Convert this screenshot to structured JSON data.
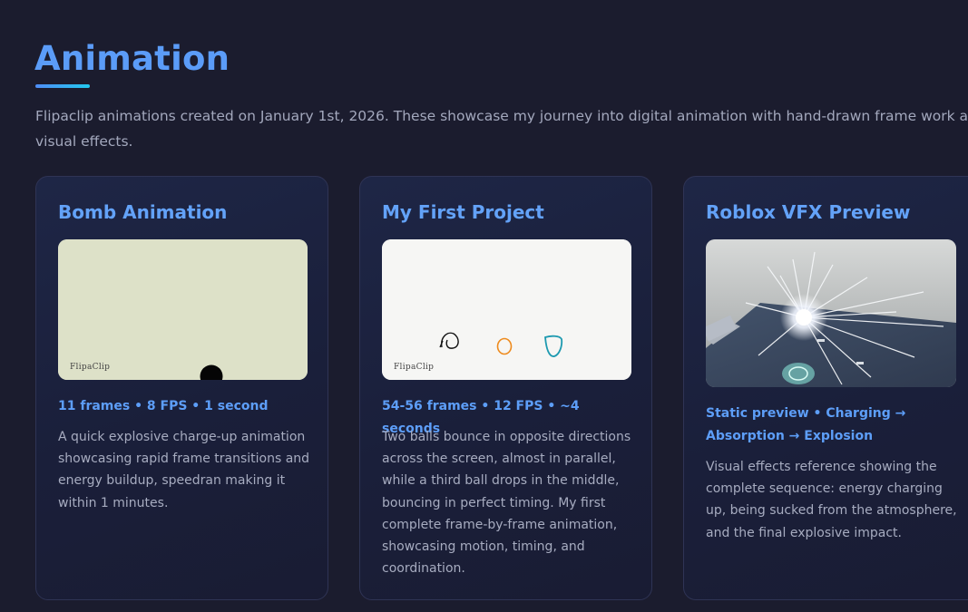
{
  "header": {
    "title": "Animation",
    "intro": "Flipaclip animations created on January 1st, 2026. These showcase my journey into digital animation with hand-drawn frame work and visual effects."
  },
  "colors": {
    "background": "#1b1c2e",
    "accent": "#5b9cf8",
    "underline_end": "#22c8ee",
    "card_border": "#2f3455",
    "body_text": "#a7acc0"
  },
  "cards": [
    {
      "title": "Bomb Animation",
      "watermark": "FlipaClip",
      "meta": "11 frames • 8 FPS • 1 second",
      "description": "A quick explosive charge-up animation showcasing rapid frame transitions and energy buildup, speedran making it within 1 minutes.",
      "preview_icon": "bomb-frame-image"
    },
    {
      "title": "My First Project",
      "watermark": "FlipaClip",
      "meta": "54-56 frames • 12 FPS • ~4 seconds",
      "description": "Two balls bounce in opposite directions across the screen, almost in parallel, while a third ball drops in the middle, bouncing in perfect timing. My first complete frame-by-frame animation, showcasing motion, timing, and coordination.",
      "preview_icon": "bouncing-balls-frame-image"
    },
    {
      "title": "Roblox VFX Preview",
      "meta": "Static preview • Charging → Absorption → Explosion",
      "description": "Visual effects reference showing the complete sequence: energy charging up, being sucked from the atmosphere, and the final explosive impact.",
      "preview_icon": "roblox-vfx-explosion-image"
    }
  ]
}
